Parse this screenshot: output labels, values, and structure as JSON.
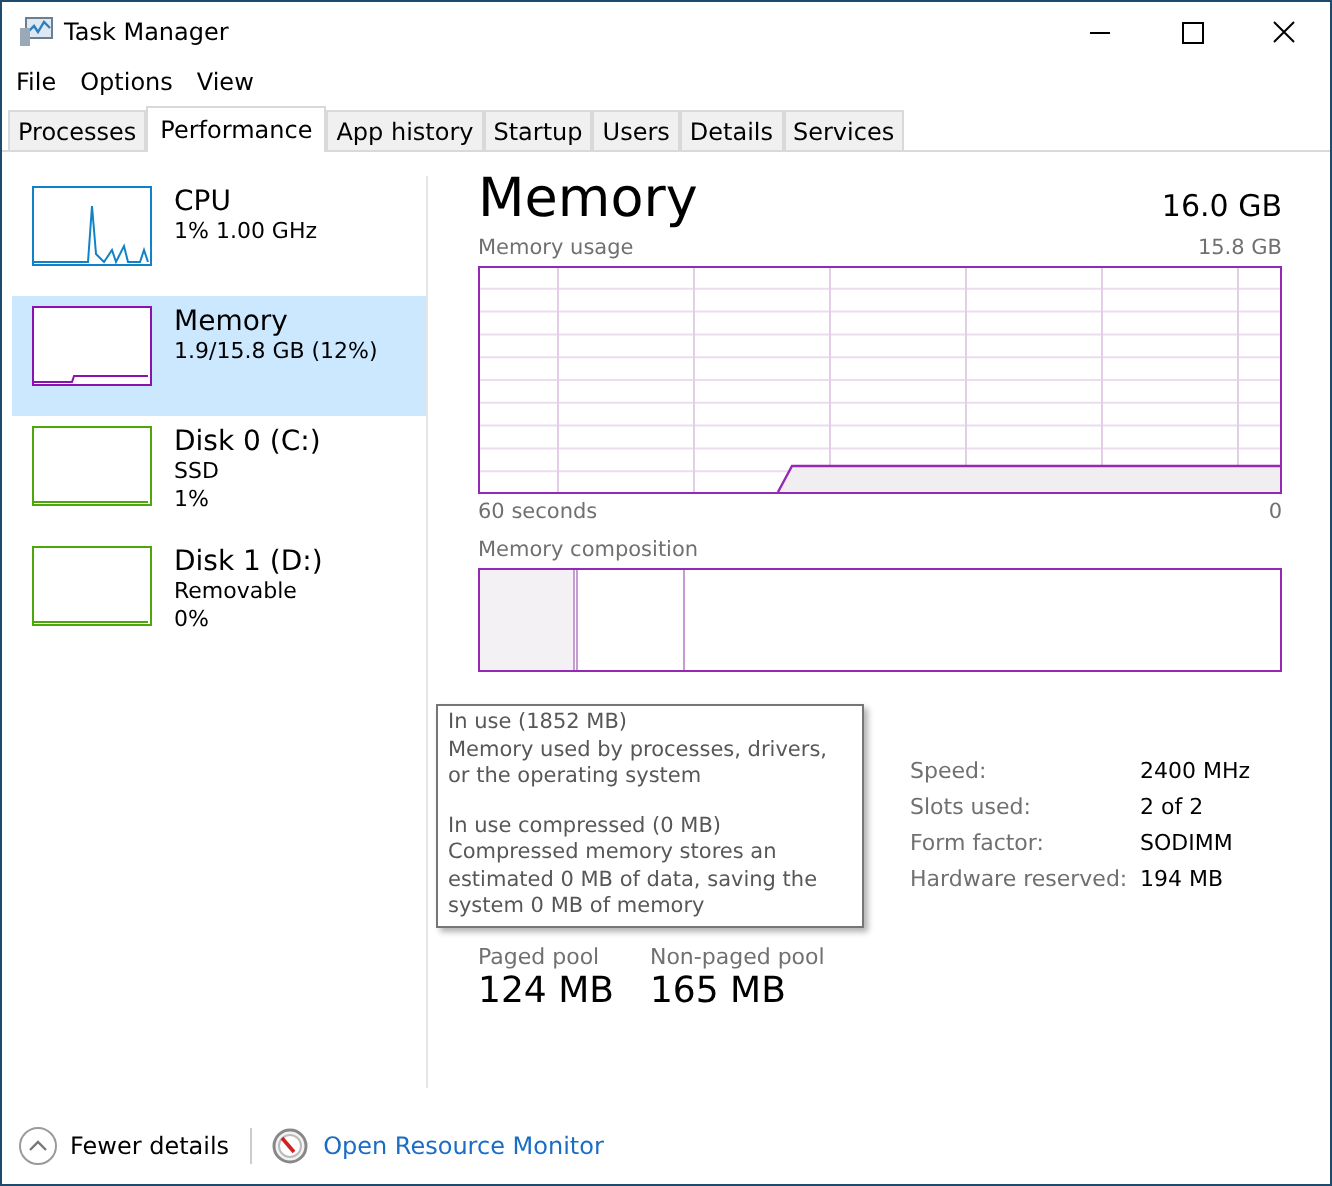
{
  "window": {
    "title": "Task Manager"
  },
  "menu": [
    "File",
    "Options",
    "View"
  ],
  "tabs": [
    {
      "label": "Processes",
      "selected": false
    },
    {
      "label": "Performance",
      "selected": true
    },
    {
      "label": "App history",
      "selected": false
    },
    {
      "label": "Startup",
      "selected": false
    },
    {
      "label": "Users",
      "selected": false
    },
    {
      "label": "Details",
      "selected": false
    },
    {
      "label": "Services",
      "selected": false
    }
  ],
  "sidebar": {
    "items": [
      {
        "kind": "cpu",
        "name": "CPU",
        "lines": [
          "1% 1.00 GHz"
        ],
        "color": "#1182c8",
        "selected": false
      },
      {
        "kind": "memory",
        "name": "Memory",
        "lines": [
          "1.9/15.8 GB (12%)"
        ],
        "color": "#8b12ae",
        "selected": true
      },
      {
        "kind": "disk",
        "name": "Disk 0 (C:)",
        "lines": [
          "SSD",
          "1%"
        ],
        "color": "#4da60c",
        "selected": false
      },
      {
        "kind": "disk",
        "name": "Disk 1 (D:)",
        "lines": [
          "Removable",
          "0%"
        ],
        "color": "#4da60c",
        "selected": false
      }
    ]
  },
  "detail": {
    "title": "Memory",
    "total": "16.0 GB",
    "usage_label": "Memory usage",
    "usage_max": "15.8 GB",
    "time_start": "60 seconds",
    "time_end": "0",
    "composition_label": "Memory composition",
    "specs": [
      {
        "label": "Speed:",
        "value": "2400 MHz"
      },
      {
        "label": "Slots used:",
        "value": "2 of 2"
      },
      {
        "label": "Form factor:",
        "value": "SODIMM"
      },
      {
        "label": "Hardware reserved:",
        "value": "194 MB"
      }
    ],
    "pools": [
      {
        "label": "Paged pool",
        "value": "124 MB"
      },
      {
        "label": "Non-paged pool",
        "value": "165 MB"
      }
    ],
    "tooltip": {
      "sections": [
        {
          "heading": "In use (1852 MB)",
          "text": "Memory used by processes, drivers, or the operating system"
        },
        {
          "heading": "In use compressed (0 MB)",
          "text": "Compressed memory stores an estimated 0 MB of data, saving the system 0 MB of memory"
        }
      ]
    }
  },
  "footer": {
    "fewer_details": "Fewer details",
    "link": "Open Resource Monitor"
  }
}
